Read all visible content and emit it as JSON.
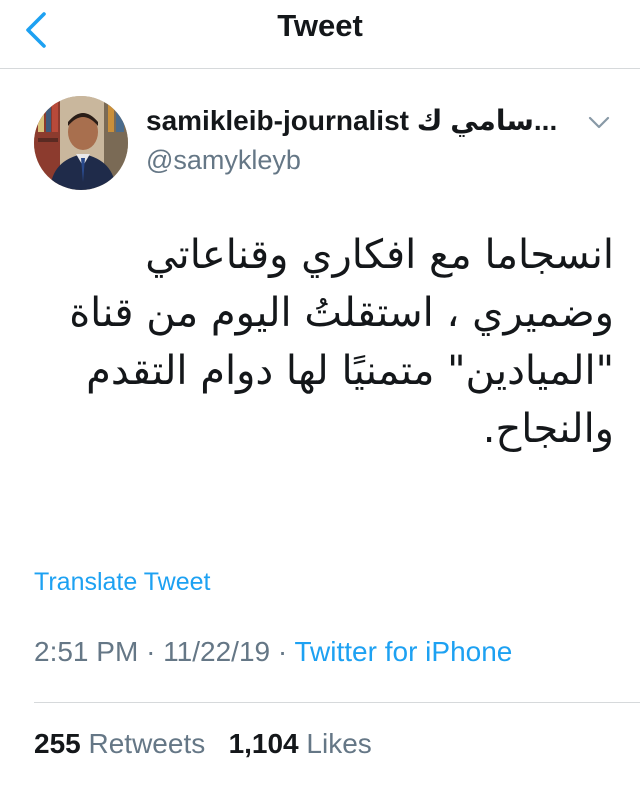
{
  "navbar": {
    "title": "Tweet",
    "back_icon": "chevron-left-icon",
    "accent": "#1da1f2"
  },
  "author": {
    "display_name": "samikleib-journalist سامي ك...",
    "handle": "@samykleyb",
    "caret_icon": "chevron-down-icon"
  },
  "tweet": {
    "lines": [
      "انسجاما مع افكاري وقناعاتي",
      "وضميري ، استقلتُ اليوم من قناة",
      "\"الميادين\" متمنيًا لها دوام التقدم",
      "والنجاح."
    ]
  },
  "translate_label": "Translate Tweet",
  "meta": {
    "time": "2:51 PM",
    "separator": "·",
    "date": "11/22/19",
    "source": "Twitter for iPhone"
  },
  "stats": {
    "retweets_count": "255",
    "retweets_label": "Retweets",
    "likes_count": "1,104",
    "likes_label": "Likes"
  },
  "colors": {
    "text": "#14171a",
    "secondary": "#657786",
    "link": "#1da1f2",
    "divider": "#d6d9db"
  }
}
